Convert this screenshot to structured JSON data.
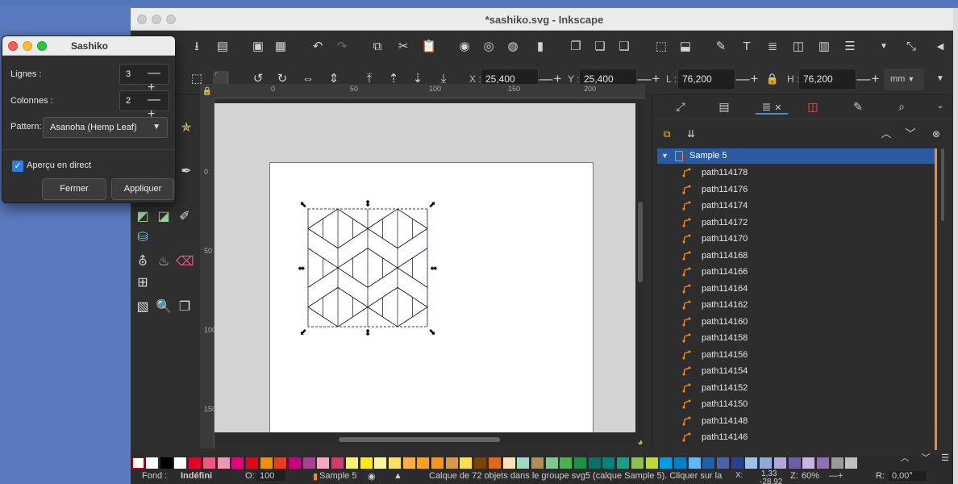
{
  "window": {
    "title": "*sashiko.svg - Inkscape"
  },
  "controls": {
    "x_label": "X :",
    "x_value": "25,400",
    "y_label": "Y :",
    "y_value": "25,400",
    "w_label": "L :",
    "w_value": "76,200",
    "h_label": "H :",
    "h_value": "76,200",
    "pm": "—+",
    "unit": "mm"
  },
  "ruler": {
    "h_ticks": [
      "0",
      "50",
      "100",
      "150",
      "200"
    ],
    "v_ticks": [
      "0",
      "50",
      "100",
      "150"
    ]
  },
  "panel": {
    "layer": "Sample 5",
    "objects": [
      "path114178",
      "path114176",
      "path114174",
      "path114172",
      "path114170",
      "path114168",
      "path114166",
      "path114164",
      "path114162",
      "path114160",
      "path114158",
      "path114156",
      "path114154",
      "path114152",
      "path114150",
      "path114148",
      "path114146"
    ]
  },
  "palette": [
    "#ffffff",
    "#000000",
    "#ffffff",
    "#e4002b",
    "#ea5a7e",
    "#f493b4",
    "#e6007e",
    "#e30613",
    "#f29100",
    "#e83e1d",
    "#c6007e",
    "#a4448f",
    "#f4aab9",
    "#d03c6b",
    "#fff36d",
    "#ffed00",
    "#fff59d",
    "#fce05f",
    "#fbb040",
    "#f9a21f",
    "#f7941d",
    "#d79a4b",
    "#fde047",
    "#7a4400",
    "#e06a1a",
    "#f9e2b8",
    "#a0d9c8",
    "#aa8f5c",
    "#7fc88e",
    "#4caf50",
    "#1d8f4a",
    "#0d6e63",
    "#00837e",
    "#16a085",
    "#8bc34a",
    "#c1d82f",
    "#009fe3",
    "#0080c6",
    "#64b5f6",
    "#1f5fa8",
    "#4a62a8",
    "#2a3f8f",
    "#9dc3e6",
    "#8ea9db",
    "#b5a6d9",
    "#6f5ba7",
    "#c9b3e0",
    "#8f6fb6",
    "#9b9b9b",
    "#c0c0c0"
  ],
  "status": {
    "fill_label": "Fond :",
    "fill_value": "Indéfini",
    "opacity_label": "O:",
    "opacity_value": "100",
    "layer_value": "Sample 5",
    "message": "Calque de 72 objets dans le groupe svg5 (calque Sample 5). Cliquer sur la",
    "x_label": "X:",
    "x_value": "1,33",
    "y_value": "-28,92",
    "z_label": "Z:",
    "zoom": "60%",
    "r_label": "R:",
    "rotation": "0,00°"
  },
  "dialog": {
    "title": "Sashiko",
    "rows_label": "Lignes :",
    "rows_value": "3",
    "cols_label": "Colonnes :",
    "cols_value": "2",
    "pattern_label": "Pattern:",
    "pattern_value": "Asanoha (Hemp Leaf)",
    "preview_label": "Aperçu en direct",
    "close_label": "Fermer",
    "apply_label": "Appliquer"
  }
}
